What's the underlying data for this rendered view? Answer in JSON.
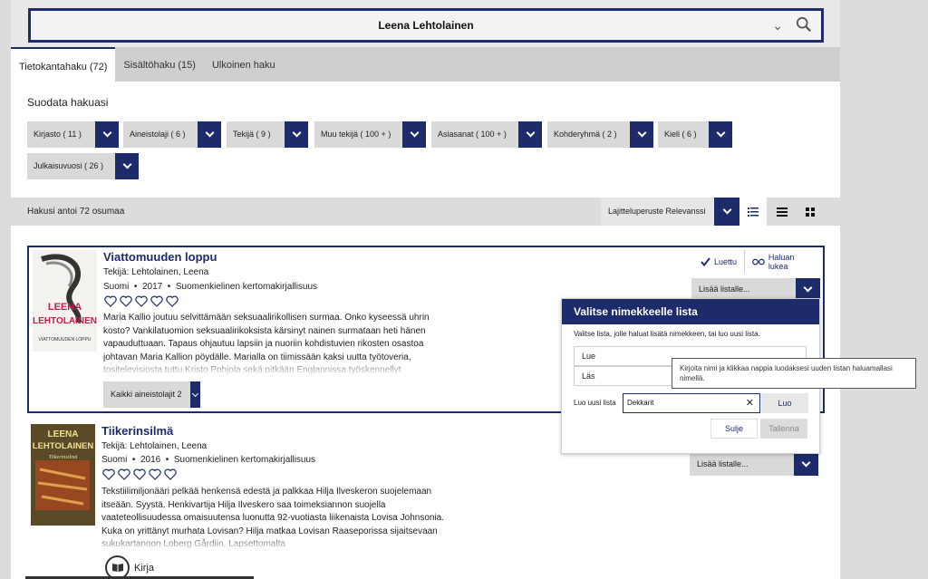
{
  "search": {
    "query": "Leena Lehtolainen"
  },
  "tabs": [
    {
      "label": "Tietokantahaku (72)"
    },
    {
      "label": "Sisältöhaku (15)"
    },
    {
      "label": "Ulkoinen haku"
    }
  ],
  "filters": {
    "title": "Suodata hakuasi",
    "items": [
      {
        "label": "Kirjasto",
        "count": "( 11 )"
      },
      {
        "label": "Aineistolaji",
        "count": "( 6 )"
      },
      {
        "label": "Tekijä",
        "count": "( 9 )"
      },
      {
        "label": "Muu tekijä",
        "count": "( 100 + )"
      },
      {
        "label": "Asiasanat",
        "count": "( 100 + )"
      },
      {
        "label": "Kohderyhmä",
        "count": "( 2 )"
      },
      {
        "label": "Kieli",
        "count": "( 6 )"
      },
      {
        "label": "Julkaisuvuosi",
        "count": "( 26 )"
      }
    ]
  },
  "results": {
    "count_text": "Hakusi antoi 72 osumaa",
    "sort_label": "Lajitteluperuste Relevanssi"
  },
  "items": [
    {
      "title": "Viattomuuden loppu",
      "author": "Tekijä: Lehtolainen, Leena",
      "language": "Suomi",
      "year": "2017",
      "genre": "Suomenkielinen kertomakirjallisuus",
      "description": "Maria Kallio joutuu selvittämään seksuaalirikollisen surmaa. Onko kyseessä uhrin kosto? Vankilatuomion seksuaalirikoksista kärsinyt nainen surmataan heti hänen vapauduttuaan. Tapaus ohjautuu lapsiin ja nuoriin kohdistuvien rikosten osastoa johtavan Maria Kallion pöydälle. Marialla on tiimissään kaksi uutta työtoveria, tositelevisiosta tuttu Kristo Pohjola sekä pitkään Englannissa työskennellyt",
      "formats_label": "Kaikki aineistolajit 2",
      "cover_author": "LEENA LEHTOLAINEN",
      "cover_title": "VIATTOMUUDEN LOPPU",
      "read_label": "Luettu",
      "want_label": "Haluan lukea",
      "add_list_label": "Lisää listalle..."
    },
    {
      "title": "Tiikerinsilmä",
      "author": "Tekijä: Lehtolainen, Leena",
      "language": "Suomi",
      "year": "2016",
      "genre": "Suomenkielinen kertomakirjallisuus",
      "description": "Tekstiilimiljonääri pelkää henkensä edestä ja palkkaa Hilja Ilveskeron suojelemaan itseään. Syystä. Henkivartija Hilja Ilveskero saa toimeksiannon suojella vaateteollisuudessa omaisuutensa luonutta 92-vuotiasta liikenaista Lovisa Johnsonia. Kuka on yrittänyt murhata Lovisan? Hilja matkaa Lovisan Raaseporissa sijaitsevaan sukukartanoon Loberg Gårdiin. Lapsettomalta",
      "format": "Kirja",
      "cover_author": "LEENA LEHTOLAINEN",
      "cover_title": "Tiikerinsilmä",
      "add_list_label": "Lisää listalle..."
    }
  ],
  "dialog": {
    "title": "Valitse nimekkeelle lista",
    "intro": "Valitse lista, jolle haluat lisätä nimekkeen, tai luo uusi lista.",
    "lists": [
      "Lue",
      "Läs"
    ],
    "new_label": "Luo uusi lista",
    "new_value": "Dekkarit",
    "create_label": "Luo",
    "close_label": "Sulje",
    "save_label": "Tallenna",
    "tooltip": "Kirjoita nimi ja klikkaa nappia luodaksesi uuden listan haluamallasi nimellä."
  },
  "colors": {
    "accent": "#1d2b6b",
    "panel": "#d9d9d9"
  }
}
